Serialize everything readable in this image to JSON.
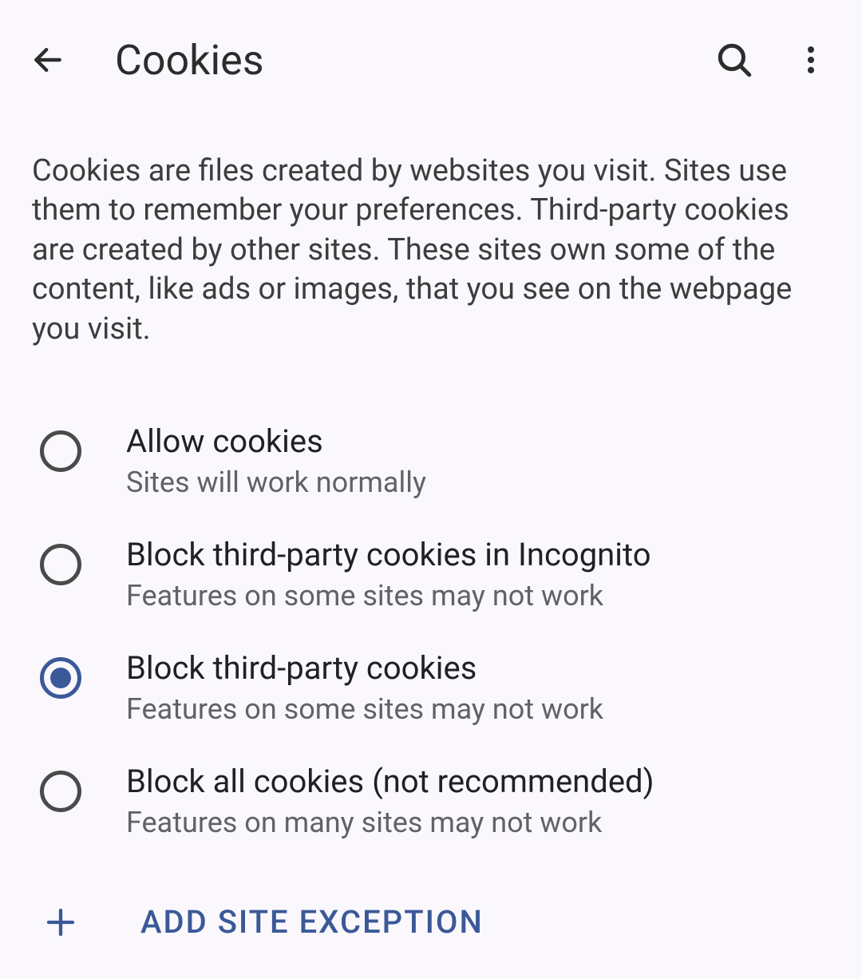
{
  "header": {
    "title": "Cookies"
  },
  "description": "Cookies are files created by websites you visit. Sites use them to remember your preferences. Third-party cookies are created by other sites. These sites own some of the content, like ads or images, that you see on the webpage you visit.",
  "options": [
    {
      "label": "Allow cookies",
      "sub": "Sites will work normally",
      "selected": false
    },
    {
      "label": "Block third-party cookies in Incognito",
      "sub": "Features on some sites may not work",
      "selected": false
    },
    {
      "label": "Block third-party cookies",
      "sub": "Features on some sites may not work",
      "selected": true
    },
    {
      "label": "Block all cookies (not recommended)",
      "sub": "Features on many sites may not work",
      "selected": false
    }
  ],
  "add_exception_label": "ADD SITE EXCEPTION",
  "colors": {
    "accent": "#3b5998",
    "background": "#faf8fc"
  }
}
